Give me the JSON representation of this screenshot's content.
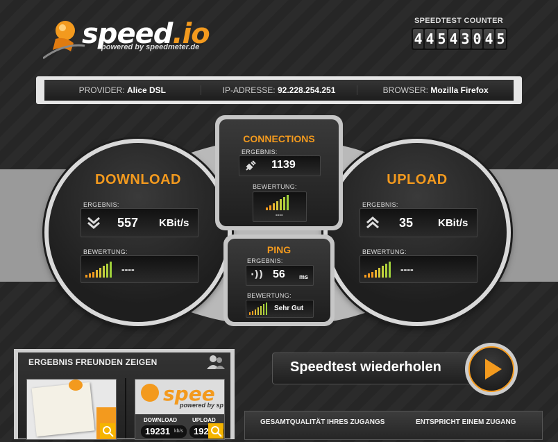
{
  "logo": {
    "text_main": "speed",
    "text_dot": ".io",
    "subtitle": "powered by speedmeter.de"
  },
  "counter": {
    "title": "SPEEDTEST COUNTER",
    "digits": [
      "4",
      "4",
      "5",
      "4",
      "3",
      "0",
      "4",
      "5"
    ]
  },
  "info": {
    "provider_label": "PROVIDER:",
    "provider_value": "Alice DSL",
    "ip_label": "IP-ADRESSE:",
    "ip_value": "92.228.254.251",
    "browser_label": "BROWSER:",
    "browser_value": "Mozilla Firefox"
  },
  "download": {
    "title": "DOWNLOAD",
    "result_label": "ERGEBNIS:",
    "value": "557",
    "unit": "KBit/s",
    "rating_label": "BEWERTUNG:",
    "rating": "----"
  },
  "upload": {
    "title": "UPLOAD",
    "result_label": "ERGEBNIS:",
    "value": "35",
    "unit": "KBit/s",
    "rating_label": "BEWERTUNG:",
    "rating": "----"
  },
  "connections": {
    "title": "CONNECTIONS",
    "result_label": "ERGEBNIS:",
    "value": "1139",
    "rating_label": "BEWERTUNG:",
    "rating": "----"
  },
  "ping": {
    "title": "PING",
    "result_label": "ERGEBNIS:",
    "value": "56",
    "unit": "ms",
    "rating_label": "BEWERTUNG:",
    "rating": "Sehr Gut"
  },
  "share": {
    "title": "ERGEBNIS FREUNDEN ZEIGEN",
    "thumb2_logo": "spee",
    "thumb2_sub": "powered by sp",
    "thumb2_dl_label": "DOWNLOAD",
    "thumb2_ul_label": "UPLOAD",
    "thumb2_dl_value": "19231",
    "thumb2_dl_unit": "kb/s",
    "thumb2_ul_value": "192"
  },
  "repeat_button": {
    "label": "Speedtest wiederholen"
  },
  "quality": {
    "left_label": "GESAMTQUALITÄT IHRES ZUGANGS",
    "right_label": "ENTSPRICHT EINEM ZUGANG"
  },
  "colors": {
    "accent": "#f39a1e",
    "bar_green": "#9fd13b",
    "bar_orange": "#f39a1e"
  }
}
